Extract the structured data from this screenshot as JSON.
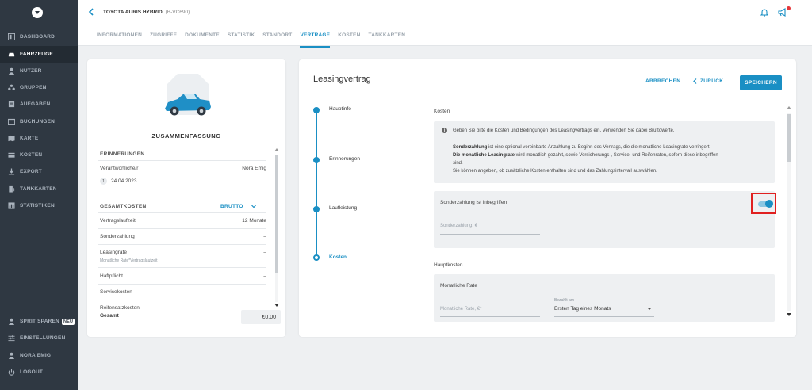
{
  "sidebar": {
    "logo_icon": "shield-chevron-logo",
    "items": [
      {
        "label": "DASHBOARD",
        "icon": "dashboard-icon",
        "active": false
      },
      {
        "label": "FAHRZEUGE",
        "icon": "car-icon",
        "active": true
      },
      {
        "label": "NUTZER",
        "icon": "user-icon",
        "active": false
      },
      {
        "label": "GRUPPEN",
        "icon": "groups-icon",
        "active": false
      },
      {
        "label": "AUFGABEN",
        "icon": "tasks-icon",
        "active": false
      },
      {
        "label": "BUCHUNGEN",
        "icon": "calendar-icon",
        "active": false
      },
      {
        "label": "KARTE",
        "icon": "map-icon",
        "active": false
      },
      {
        "label": "KOSTEN",
        "icon": "wallet-icon",
        "active": false
      },
      {
        "label": "EXPORT",
        "icon": "download-icon",
        "active": false
      },
      {
        "label": "TANKKARTEN",
        "icon": "fuel-card-icon",
        "active": false
      },
      {
        "label": "STATISTIKEN",
        "icon": "chart-icon",
        "active": false
      }
    ],
    "bottom_items": [
      {
        "label": "SPRIT SPAREN",
        "icon": "user-icon",
        "badge": "NEU"
      },
      {
        "label": "EINSTELLUNGEN",
        "icon": "sliders-icon"
      },
      {
        "label": "NORA EMIG",
        "icon": "user-icon"
      },
      {
        "label": "LOGOUT",
        "icon": "power-icon"
      }
    ]
  },
  "header": {
    "vehicle_name": "TOYOTA AURIS HYBRID",
    "vehicle_plate": "(B-VC690)",
    "tabs": [
      {
        "label": "INFORMATIONEN",
        "active": false
      },
      {
        "label": "ZUGRIFFE",
        "active": false
      },
      {
        "label": "DOKUMENTE",
        "active": false
      },
      {
        "label": "STATISTIK",
        "active": false
      },
      {
        "label": "STANDORT",
        "active": false
      },
      {
        "label": "VERTRÄGE",
        "active": true
      },
      {
        "label": "KOSTEN",
        "active": false
      },
      {
        "label": "TANKKARTEN",
        "active": false
      }
    ],
    "accent_color": "#1a8fc4",
    "notification_color": "#e5363a"
  },
  "summary": {
    "title": "ZUSAMMENFASSUNG",
    "reminders_title": "ERINNERUNGEN",
    "responsible_label": "Verantwortliche/r",
    "responsible_value": "Nora Emig",
    "reminder_count": "1",
    "reminder_date": "24.04.2023",
    "total_costs_title": "GESAMTKOSTEN",
    "brutto_label": "BRUTTO",
    "rows": [
      {
        "label": "Vertragslaufzeit",
        "value": "12 Monate"
      },
      {
        "label": "Sonderzahlung",
        "value": "–"
      },
      {
        "label": "Leasingrate",
        "sub": "Monatliche Rate*Vertragslaufzeit",
        "value": "–"
      },
      {
        "label": "Haftpflicht",
        "value": "–"
      },
      {
        "label": "Servicekosten",
        "value": "–"
      },
      {
        "label": "Reifensatzkosten",
        "value": "–"
      }
    ],
    "total_label": "Gesamt",
    "total_value": "€0.00"
  },
  "contract": {
    "title": "Leasingvertrag",
    "cancel_label": "ABBRECHEN",
    "back_label": "ZURÜCK",
    "save_label": "SPEICHERN",
    "steps": [
      {
        "label": "Hauptinfo",
        "current": false
      },
      {
        "label": "Erinnerungen",
        "current": false
      },
      {
        "label": "Laufleistung",
        "current": false
      },
      {
        "label": "Kosten",
        "current": true
      }
    ],
    "costs_label": "Kosten",
    "info_lines": {
      "line1": "Geben Sie bitte die Kosten und Bedingungen des Leasingvertrags ein. Verwenden Sie dabei Bruttowerte.",
      "line2_bold": "Sonderzahlung",
      "line2_rest": " ist eine optional vereinbarte Anzahlung zu Beginn des Vertrags, die die monatliche Leasingrate verringert.",
      "line3_bold": "Die monatliche Leasingrate",
      "line3_rest": " wird monatlich gezahlt, sowie Versicherungs-, Service- und Reifenraten, sofern diese inbegriffen",
      "line4": "sind.",
      "line5": "Sie können angeben, ob zusätzliche Kosten enthalten sind und das Zahlungsintervall auswählen."
    },
    "toggle_label": "Sonderzahlung ist inbegriffen",
    "toggle_on": true,
    "sonderzahlung_placeholder": "Sonderzahlung, €",
    "hauptkosten_label": "Hauptkosten",
    "monatliche_rate_title": "Monatliche Rate",
    "monatliche_rate_placeholder": "Monatliche Rate, €*",
    "bezahlt_am_label": "Bezahlt am",
    "bezahlt_am_value": "Ersten Tag eines Monats"
  }
}
